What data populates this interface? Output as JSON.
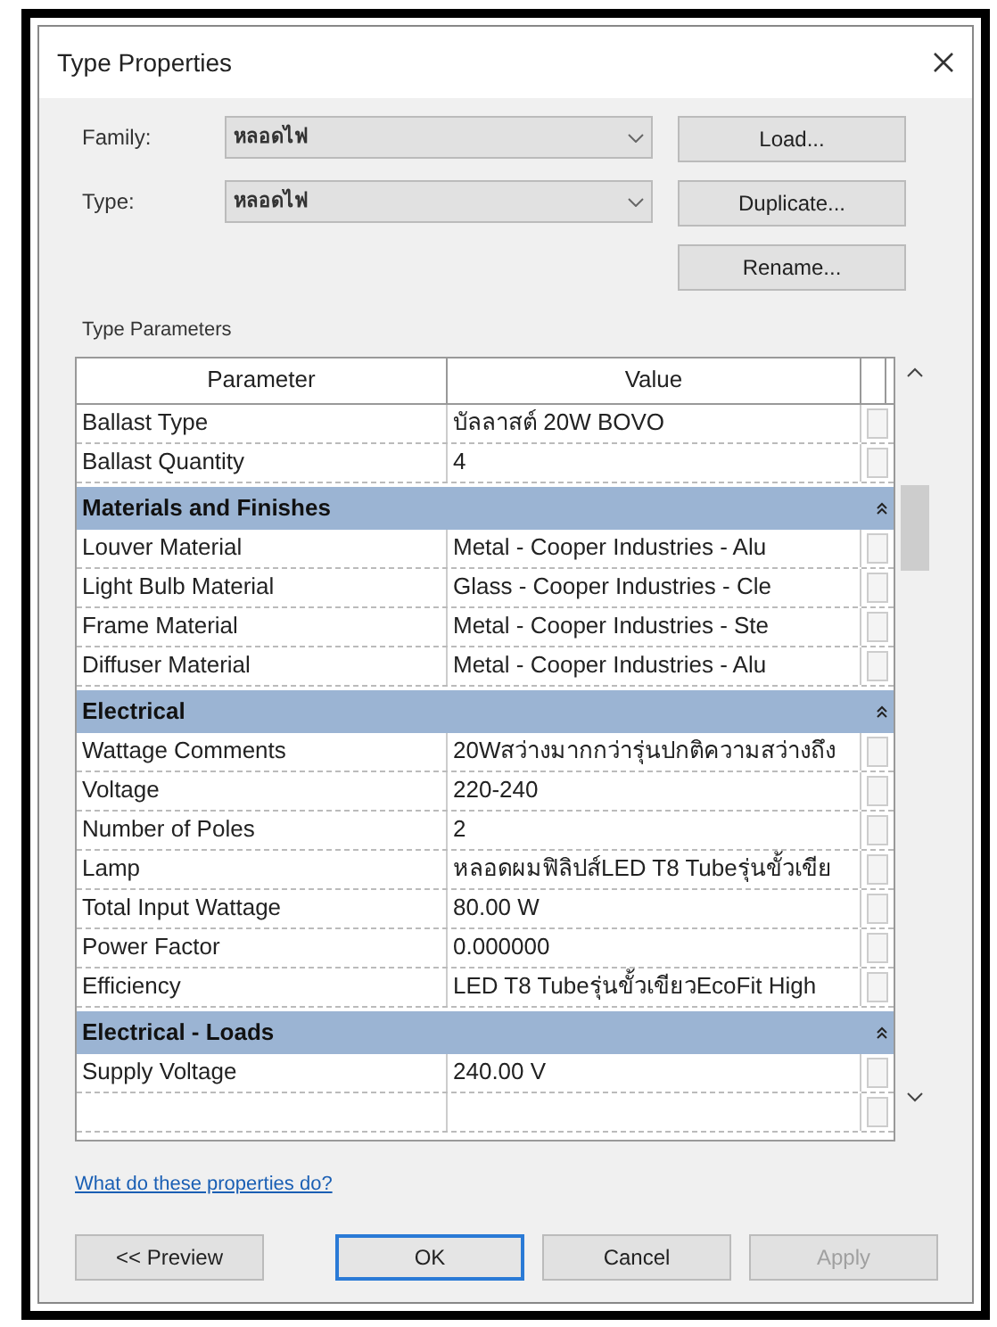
{
  "window": {
    "title": "Type Properties"
  },
  "fields": [
    {
      "label": "Family:",
      "value": "หลอดไฟ"
    },
    {
      "label": "Type:",
      "value": "หลอดไฟ"
    }
  ],
  "side_buttons": [
    "Load...",
    "Duplicate...",
    "Rename..."
  ],
  "section_label": "Type Parameters",
  "table": {
    "columns": [
      "Parameter",
      "Value"
    ],
    "rows": [
      {
        "kind": "param",
        "name": "Ballast Type",
        "value": "บัลลาสต์ 20W BOVO"
      },
      {
        "kind": "param",
        "name": "Ballast Quantity",
        "value": "4"
      },
      {
        "kind": "group",
        "name": "Materials and Finishes"
      },
      {
        "kind": "param",
        "name": "Louver Material",
        "value": "Metal - Cooper Industries - Alu"
      },
      {
        "kind": "param",
        "name": "Light Bulb Material",
        "value": "Glass - Cooper Industries - Cle"
      },
      {
        "kind": "param",
        "name": "Frame Material",
        "value": "Metal - Cooper Industries - Ste"
      },
      {
        "kind": "param",
        "name": "Diffuser Material",
        "value": "Metal - Cooper Industries - Alu"
      },
      {
        "kind": "group",
        "name": "Electrical"
      },
      {
        "kind": "param",
        "name": "Wattage Comments",
        "value": "20Wสว่างมากกว่ารุ่นปกติความสว่างถึง"
      },
      {
        "kind": "param",
        "name": "Voltage",
        "value": "220-240"
      },
      {
        "kind": "param",
        "name": "Number of Poles",
        "value": "2"
      },
      {
        "kind": "param",
        "name": "Lamp",
        "value": "หลอดผมฟิลิปส์LED T8 Tubeรุ่นขั้วเขีย"
      },
      {
        "kind": "param",
        "name": "Total Input Wattage",
        "value": "80.00 W"
      },
      {
        "kind": "param",
        "name": "Power Factor",
        "value": "0.000000"
      },
      {
        "kind": "param",
        "name": "Efficiency",
        "value": "LED T8 Tubeรุ่นขั้วเขียวEcoFit High"
      },
      {
        "kind": "group",
        "name": "Electrical - Loads"
      },
      {
        "kind": "param",
        "name": "Supply Voltage",
        "value": "240.00 V"
      },
      {
        "kind": "cut"
      }
    ]
  },
  "help_link": "What do these properties do?",
  "buttons": [
    {
      "label": "<< Preview",
      "default": false,
      "disabled": false
    },
    {
      "label": "OK",
      "default": true,
      "disabled": false
    },
    {
      "label": "Cancel",
      "default": false,
      "disabled": false
    },
    {
      "label": "Apply",
      "default": false,
      "disabled": true
    }
  ]
}
